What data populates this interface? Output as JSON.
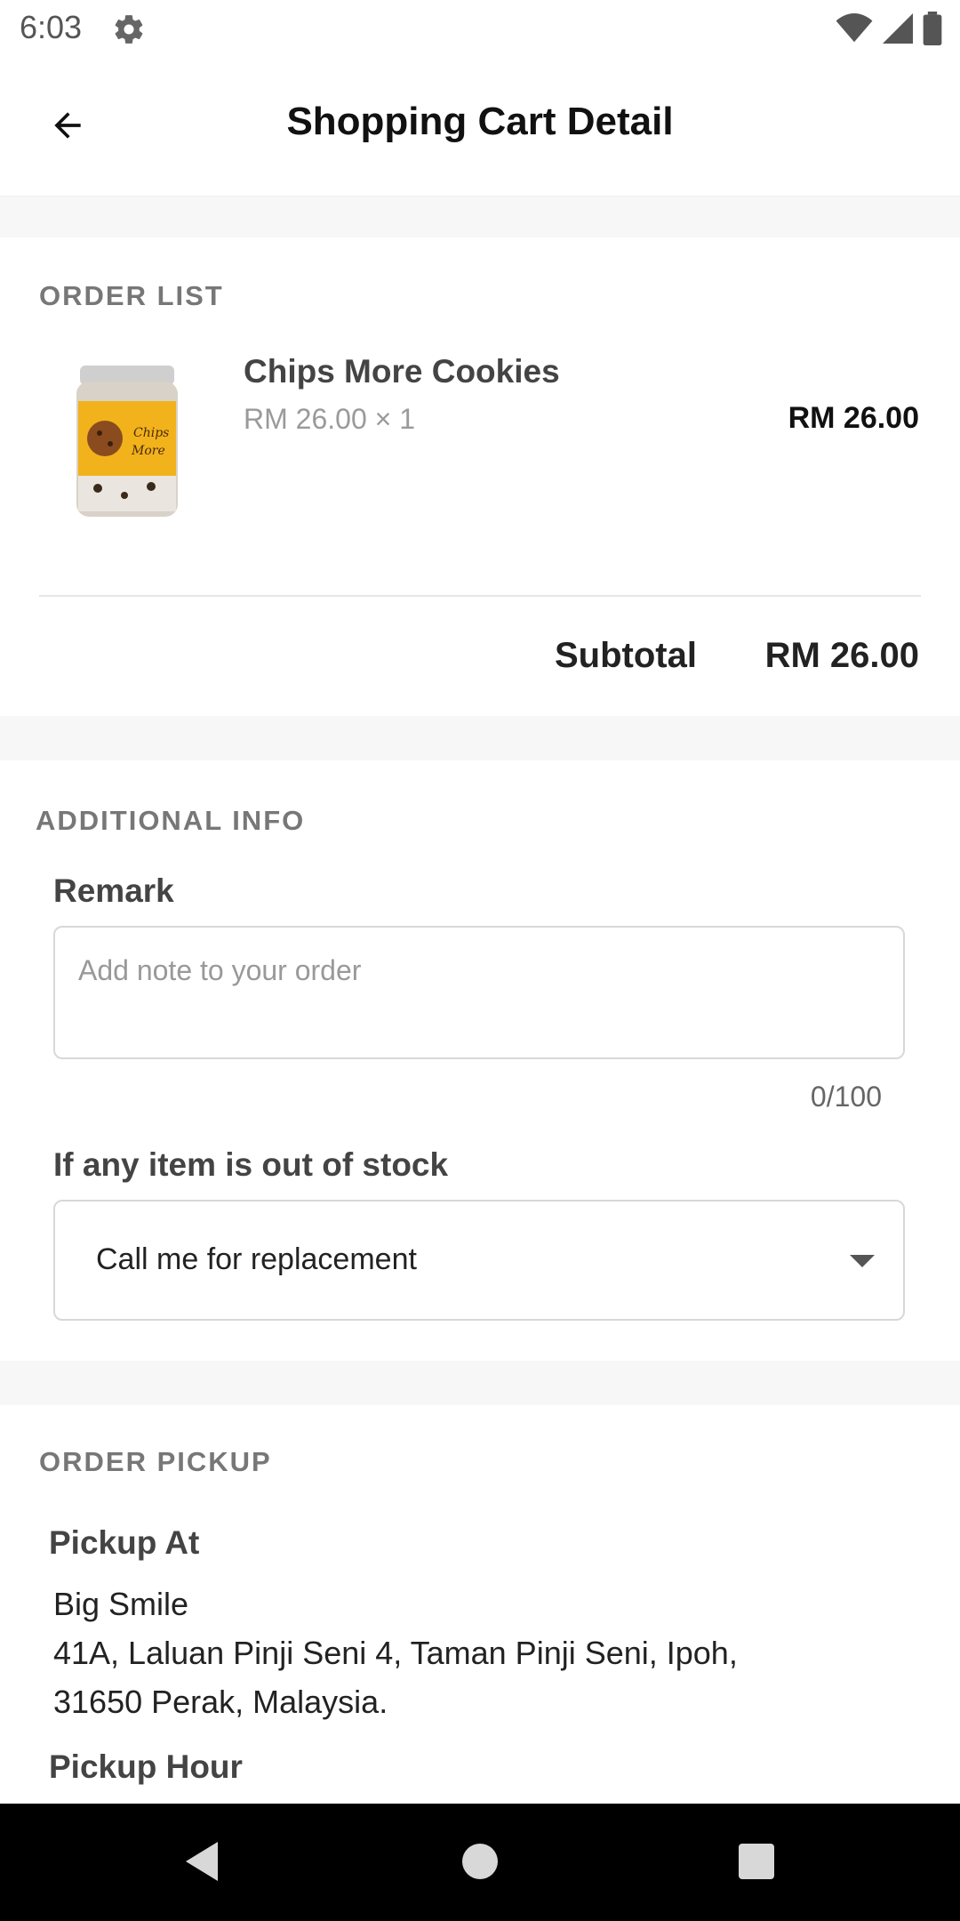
{
  "status_bar": {
    "time": "6:03",
    "icons": [
      "gear-icon",
      "wifi-icon",
      "signal-icon",
      "battery-icon"
    ]
  },
  "header": {
    "title": "Shopping Cart Detail",
    "back_icon": "arrow-left-icon"
  },
  "order_list": {
    "section_title": "ORDER LIST",
    "items": [
      {
        "name": "Chips More Cookies",
        "unit_price_qty": "RM 26.00 × 1",
        "total": "RM 26.00",
        "image": "cookie-jar-image"
      }
    ],
    "subtotal_label": "Subtotal",
    "subtotal_value": "RM 26.00"
  },
  "additional_info": {
    "section_title": "ADDITIONAL INFO",
    "remark_label": "Remark",
    "remark_placeholder": "Add note to your order",
    "remark_value": "",
    "char_count": "0/100",
    "stock_label": "If any item is out of stock",
    "stock_selected": "Call me for replacement"
  },
  "order_pickup": {
    "section_title": "ORDER PICKUP",
    "pickup_at_label": "Pickup At",
    "store_name": "Big Smile",
    "address_line1": "41A, Laluan Pinji Seni 4, Taman Pinji Seni, Ipoh,",
    "address_line2": "31650 Perak, Malaysia.",
    "pickup_hour_label": "Pickup Hour"
  },
  "nav_bar": {
    "icons": [
      "back-triangle-icon",
      "home-circle-icon",
      "recents-square-icon"
    ]
  },
  "colors": {
    "section_gap": "#f7f7f7",
    "section_title": "#777777",
    "nav_bg": "#000000",
    "jar_label": "#f2b21b"
  }
}
